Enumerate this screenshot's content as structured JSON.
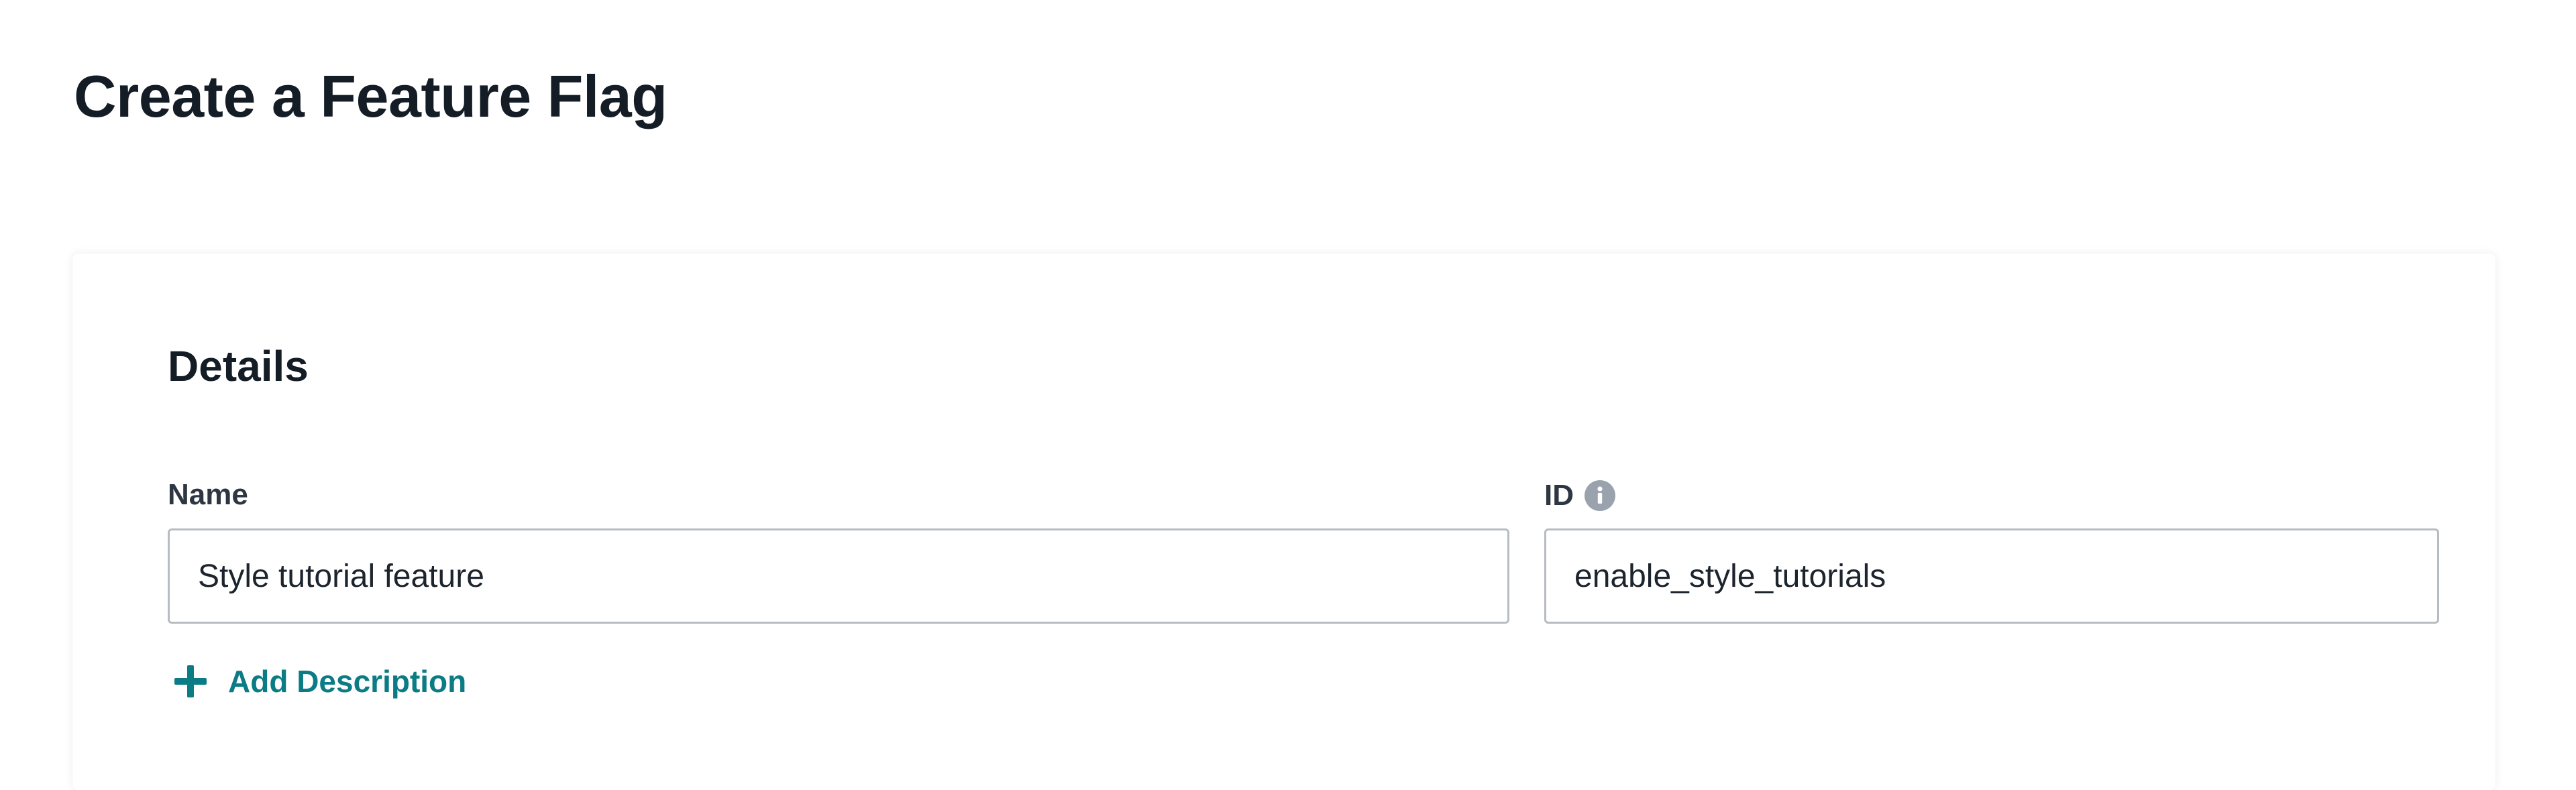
{
  "page": {
    "title": "Create a Feature Flag"
  },
  "details": {
    "section_title": "Details",
    "name_label": "Name",
    "name_value": "Style tutorial feature",
    "id_label": "ID",
    "id_value": "enable_style_tutorials",
    "id_info_icon": "info-icon",
    "add_description_label": "Add Description",
    "add_description_icon": "plus-icon"
  },
  "colors": {
    "accent": "#0b7c85",
    "heading": "#141c26",
    "input_border": "#b7bcc2",
    "info_icon": "#9aa3ad"
  }
}
